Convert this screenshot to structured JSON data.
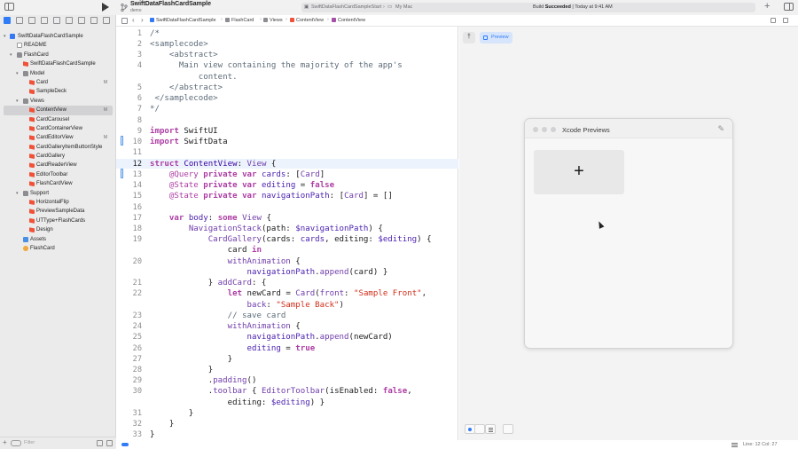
{
  "toolbar": {
    "project_title": "SwiftDataFlashCardSample",
    "project_subtitle": "demo",
    "scheme": "SwiftDataFlashCardSampleStart",
    "destination": "My Mac",
    "build_status_prefix": "Build",
    "build_status_word": "Succeeded",
    "build_status_suffix": "| Today at 9:41 AM",
    "add_label": "+"
  },
  "navigator": {
    "filter_placeholder": "Filter",
    "add_label": "+",
    "items": [
      {
        "label": "SwiftDataFlashCardSample",
        "icon": "project-icon",
        "badge": ""
      },
      {
        "label": "README",
        "icon": "document-icon",
        "badge": ""
      },
      {
        "label": "FlashCard",
        "icon": "folder-icon",
        "badge": ""
      },
      {
        "label": "SwiftDataFlashCardSample",
        "icon": "swift-file-icon",
        "badge": ""
      },
      {
        "label": "Model",
        "icon": "folder-icon",
        "badge": ""
      },
      {
        "label": "Card",
        "icon": "swift-file-icon",
        "badge": "M"
      },
      {
        "label": "SampleDeck",
        "icon": "swift-file-icon",
        "badge": ""
      },
      {
        "label": "Views",
        "icon": "folder-icon",
        "badge": ""
      },
      {
        "label": "ContentView",
        "icon": "swift-file-icon",
        "badge": "M"
      },
      {
        "label": "CardCarousel",
        "icon": "swift-file-icon",
        "badge": ""
      },
      {
        "label": "CardContainerView",
        "icon": "swift-file-icon",
        "badge": ""
      },
      {
        "label": "CardEditorView",
        "icon": "swift-file-icon",
        "badge": "M"
      },
      {
        "label": "CardGalleryItemButtonStyle",
        "icon": "swift-file-icon",
        "badge": ""
      },
      {
        "label": "CardGallery",
        "icon": "swift-file-icon",
        "badge": ""
      },
      {
        "label": "CardReaderView",
        "icon": "swift-file-icon",
        "badge": ""
      },
      {
        "label": "EditorToolbar",
        "icon": "swift-file-icon",
        "badge": ""
      },
      {
        "label": "FlashCardView",
        "icon": "swift-file-icon",
        "badge": ""
      },
      {
        "label": "Support",
        "icon": "folder-icon",
        "badge": ""
      },
      {
        "label": "HorizontalFlip",
        "icon": "swift-file-icon",
        "badge": ""
      },
      {
        "label": "PreviewSampleData",
        "icon": "swift-file-icon",
        "badge": ""
      },
      {
        "label": "UTType+FlashCards",
        "icon": "swift-file-icon",
        "badge": ""
      },
      {
        "label": "Design",
        "icon": "swift-file-icon",
        "badge": ""
      },
      {
        "label": "Assets",
        "icon": "assets-icon",
        "badge": ""
      },
      {
        "label": "FlashCard",
        "icon": "app-icon",
        "badge": ""
      }
    ]
  },
  "jumpbar": {
    "crumbs": [
      "SwiftDataFlashCardSample",
      "FlashCard",
      "Views",
      "ContentView",
      "ContentView"
    ]
  },
  "editor": {
    "line_numbers": [
      "1",
      "2",
      "3",
      "4",
      "5",
      "6",
      "7",
      "8",
      "9",
      "10",
      "11",
      "12",
      "13",
      "14",
      "15",
      "16",
      "17",
      "18",
      "19",
      "20",
      "21",
      "22",
      "23",
      "24",
      "25",
      "26",
      "27",
      "28",
      "29",
      "30",
      "31",
      "32",
      "33"
    ],
    "current_line": "12",
    "status": "Line: 12  Col: 27"
  },
  "preview": {
    "pin_label": "†",
    "tab_label": "Preview",
    "window_title": "Xcode Previews",
    "add_symbol": "+"
  },
  "colors": {
    "accent": "#2f7cf6",
    "keyword": "#ad3da4",
    "string": "#d12f1b",
    "comment": "#5d6c79",
    "type": "#703daa"
  }
}
